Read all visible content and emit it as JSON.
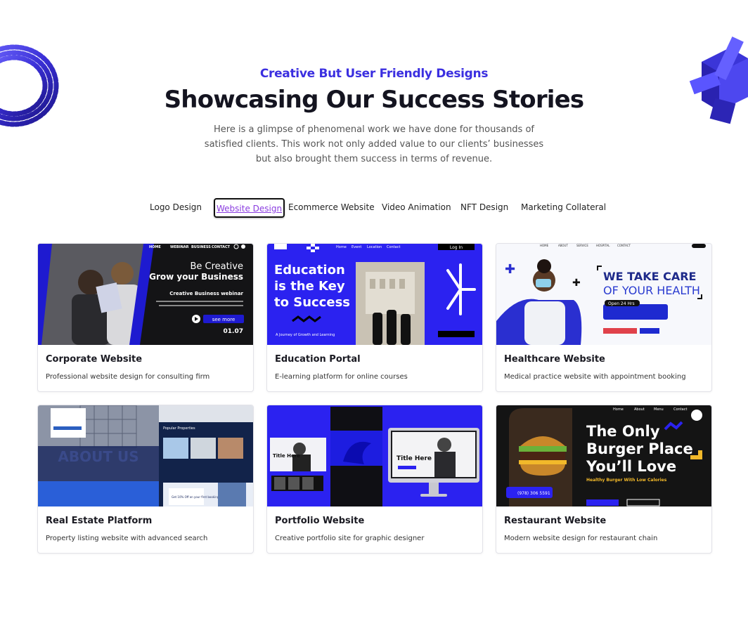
{
  "header": {
    "eyebrow": "Creative But User Friendly Designs",
    "title": "Showcasing Our Success Stories",
    "intro": "Here is a glimpse of phenomenal work we have done for thousands of satisfied clients. This work not only added value to our clients’ businesses but also brought them success in terms of revenue."
  },
  "tabs": [
    "Logo Design",
    "Website Design",
    "Ecommerce Website",
    "Video Animation",
    "NFT Design",
    "Marketing Collateral"
  ],
  "active_tab": "Website Design",
  "colors": {
    "accent": "#3b2fe0",
    "active_tab_text": "#8a3ce0",
    "heading": "#141420",
    "body": "#555555"
  },
  "cards": [
    {
      "title": "Corporate Website",
      "desc": "Professional website design for consulting firm",
      "thumb": {
        "nav": [
          "HOME",
          "WEBINAR",
          "BUSINESS",
          "CONTACT"
        ],
        "line1": "Be Creative",
        "line2": "Grow your Business",
        "line3": "Creative Business webinar",
        "cta": "see more",
        "date": "01.07"
      }
    },
    {
      "title": "Education Portal",
      "desc": "E-learning platform for online courses",
      "thumb": {
        "nav": [
          "Home",
          "Event",
          "Location",
          "Contact"
        ],
        "login": "Log In",
        "headline": [
          "Education",
          "is the Key",
          "to Success"
        ],
        "sub": "A Journey of Growth and Learning"
      }
    },
    {
      "title": "Healthcare Website",
      "desc": "Medical practice website with appointment booking",
      "thumb": {
        "nav": [
          "HOME",
          "ABOUT",
          "SERVICE",
          "HOSPITAL",
          "CONTACT"
        ],
        "headline": [
          "WE TAKE CARE",
          "OF YOUR HEALTH"
        ],
        "badge": "Open 24 Hrs"
      }
    },
    {
      "title": "Real Estate Platform",
      "desc": "Property listing website with advanced search",
      "thumb": {
        "about": "ABOUT US",
        "popular": "Popular Properties",
        "offer": "Get 10% Off on your first booking fee!"
      }
    },
    {
      "title": "Portfolio Website",
      "desc": "Creative portfolio site for graphic designer",
      "thumb": {
        "title_here": "Title Here"
      }
    },
    {
      "title": "Restaurant Website",
      "desc": "Modern website design for restaurant chain",
      "thumb": {
        "nav": [
          "Home",
          "About",
          "Menu",
          "Contact"
        ],
        "headline": [
          "The Only",
          "Burger Place",
          "You’ll Love"
        ],
        "tagline": "Healthy Burger With Low Calories",
        "phone": "(978) 306 5591"
      }
    }
  ]
}
